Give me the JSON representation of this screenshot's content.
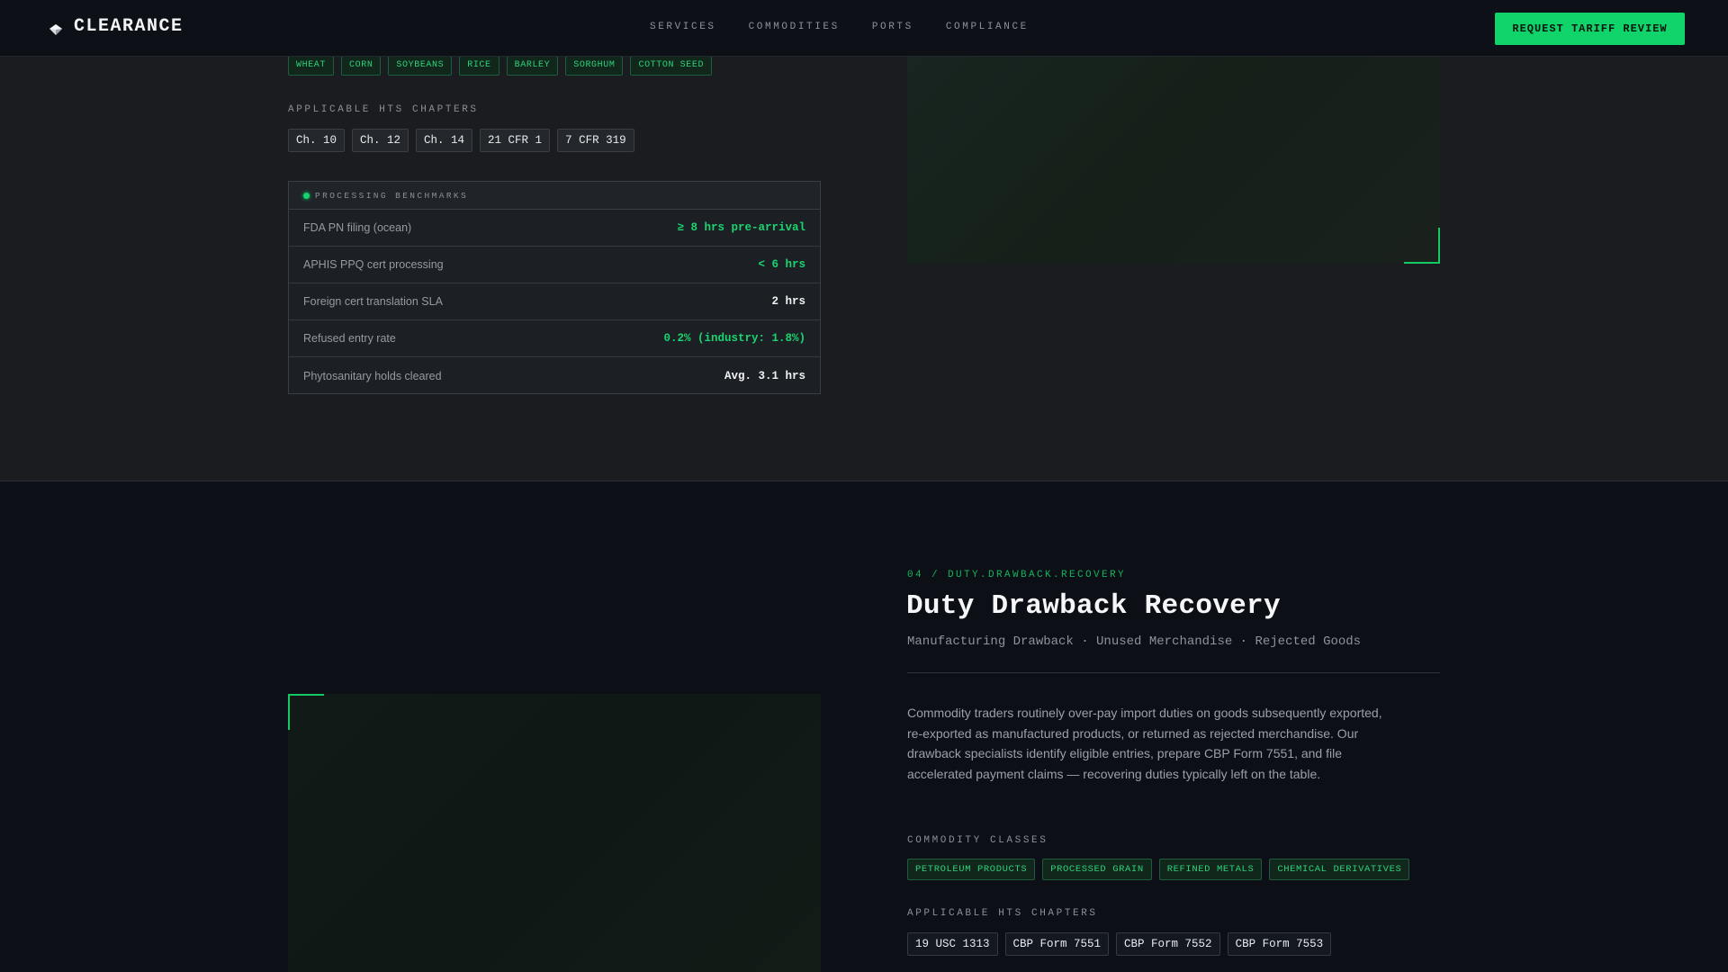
{
  "header": {
    "brand": "CLEARANCE",
    "nav": [
      "SERVICES",
      "COMMODITIES",
      "PORTS",
      "COMPLIANCE"
    ],
    "cta": "REQUEST TARIFF REVIEW",
    "logo_icon": "diamond-icon"
  },
  "section1": {
    "commodity_tags": [
      "WHEAT",
      "CORN",
      "SOYBEANS",
      "RICE",
      "BARLEY",
      "SORGHUM",
      "COTTON SEED"
    ],
    "hts_label": "APPLICABLE HTS CHAPTERS",
    "hts_chips": [
      "Ch. 10",
      "Ch. 12",
      "Ch. 14",
      "21 CFR 1",
      "7 CFR 319"
    ],
    "benchmarks": {
      "title": "PROCESSING BENCHMARKS",
      "rows": [
        {
          "label": "FDA PN filing (ocean)",
          "value": "≥ 8 hrs pre-arrival",
          "highlight": true
        },
        {
          "label": "APHIS PPQ cert processing",
          "value": "< 6 hrs",
          "highlight": true
        },
        {
          "label": "Foreign cert translation SLA",
          "value": "2 hrs",
          "highlight": false
        },
        {
          "label": "Refused entry rate",
          "value": "0.2% (industry: 1.8%)",
          "highlight": true
        },
        {
          "label": "Phytosanitary holds cleared",
          "value": "Avg. 3.1 hrs",
          "highlight": false
        }
      ]
    }
  },
  "section2": {
    "eyebrow": "04 / DUTY.DRAWBACK.RECOVERY",
    "title": "Duty Drawback Recovery",
    "subtitle": "Manufacturing Drawback · Unused Merchandise · Rejected Goods",
    "body": "Commodity traders routinely over-pay import duties on goods subsequently exported, re-exported as manufactured products, or returned as rejected merchandise. Our drawback specialists identify eligible entries, prepare CBP Form 7551, and file accelerated payment claims — recovering duties typically left on the table.",
    "classes_label": "COMMODITY CLASSES",
    "classes": [
      "PETROLEUM PRODUCTS",
      "PROCESSED GRAIN",
      "REFINED METALS",
      "CHEMICAL DERIVATIVES"
    ],
    "hts_label": "APPLICABLE HTS CHAPTERS",
    "hts_chips": [
      "19 USC 1313",
      "CBP Form 7551",
      "CBP Form 7552",
      "CBP Form 7553"
    ]
  },
  "colors": {
    "accent": "#10d46a",
    "background": "#0c0f15",
    "section_alt": "#1a1c20"
  }
}
